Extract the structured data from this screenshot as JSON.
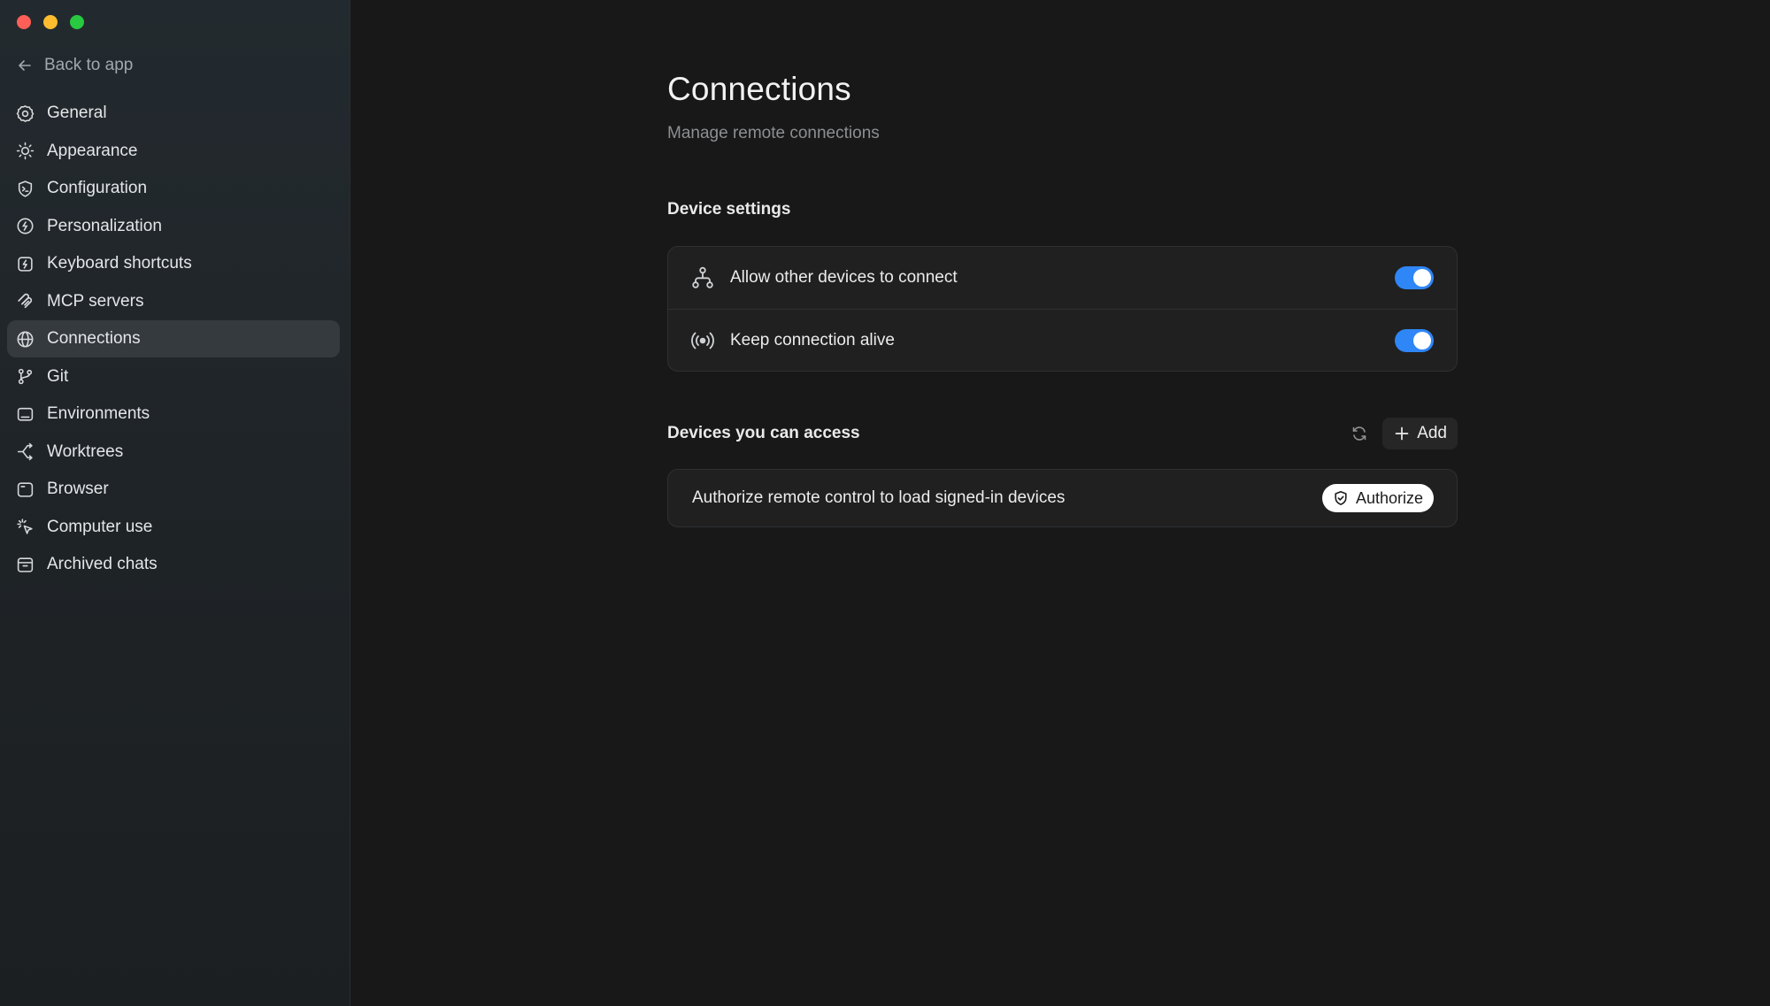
{
  "sidebar": {
    "back_label": "Back to app",
    "items": [
      {
        "label": "General",
        "icon": "gear-icon"
      },
      {
        "label": "Appearance",
        "icon": "sun-icon"
      },
      {
        "label": "Configuration",
        "icon": "shield-terminal-icon"
      },
      {
        "label": "Personalization",
        "icon": "face-icon"
      },
      {
        "label": "Keyboard shortcuts",
        "icon": "keyboard-bolt-icon"
      },
      {
        "label": "MCP servers",
        "icon": "mcp-icon"
      },
      {
        "label": "Connections",
        "icon": "globe-icon",
        "active": true
      },
      {
        "label": "Git",
        "icon": "git-branch-icon"
      },
      {
        "label": "Environments",
        "icon": "monitor-icon"
      },
      {
        "label": "Worktrees",
        "icon": "worktree-icon"
      },
      {
        "label": "Browser",
        "icon": "browser-window-icon"
      },
      {
        "label": "Computer use",
        "icon": "cursor-sparkle-icon"
      },
      {
        "label": "Archived chats",
        "icon": "archive-icon"
      }
    ]
  },
  "page": {
    "title": "Connections",
    "subtitle": "Manage remote connections"
  },
  "device_settings": {
    "title": "Device settings",
    "rows": [
      {
        "label": "Allow other devices to connect",
        "icon": "network-nodes-icon",
        "enabled": true
      },
      {
        "label": "Keep connection alive",
        "icon": "broadcast-icon",
        "enabled": true
      }
    ]
  },
  "devices": {
    "title": "Devices you can access",
    "add_label": "Add",
    "authorize_text": "Authorize remote control to load signed-in devices",
    "authorize_button": "Authorize"
  },
  "colors": {
    "accent": "#2f86f6",
    "background": "#181818",
    "sidebar": "#212629"
  }
}
